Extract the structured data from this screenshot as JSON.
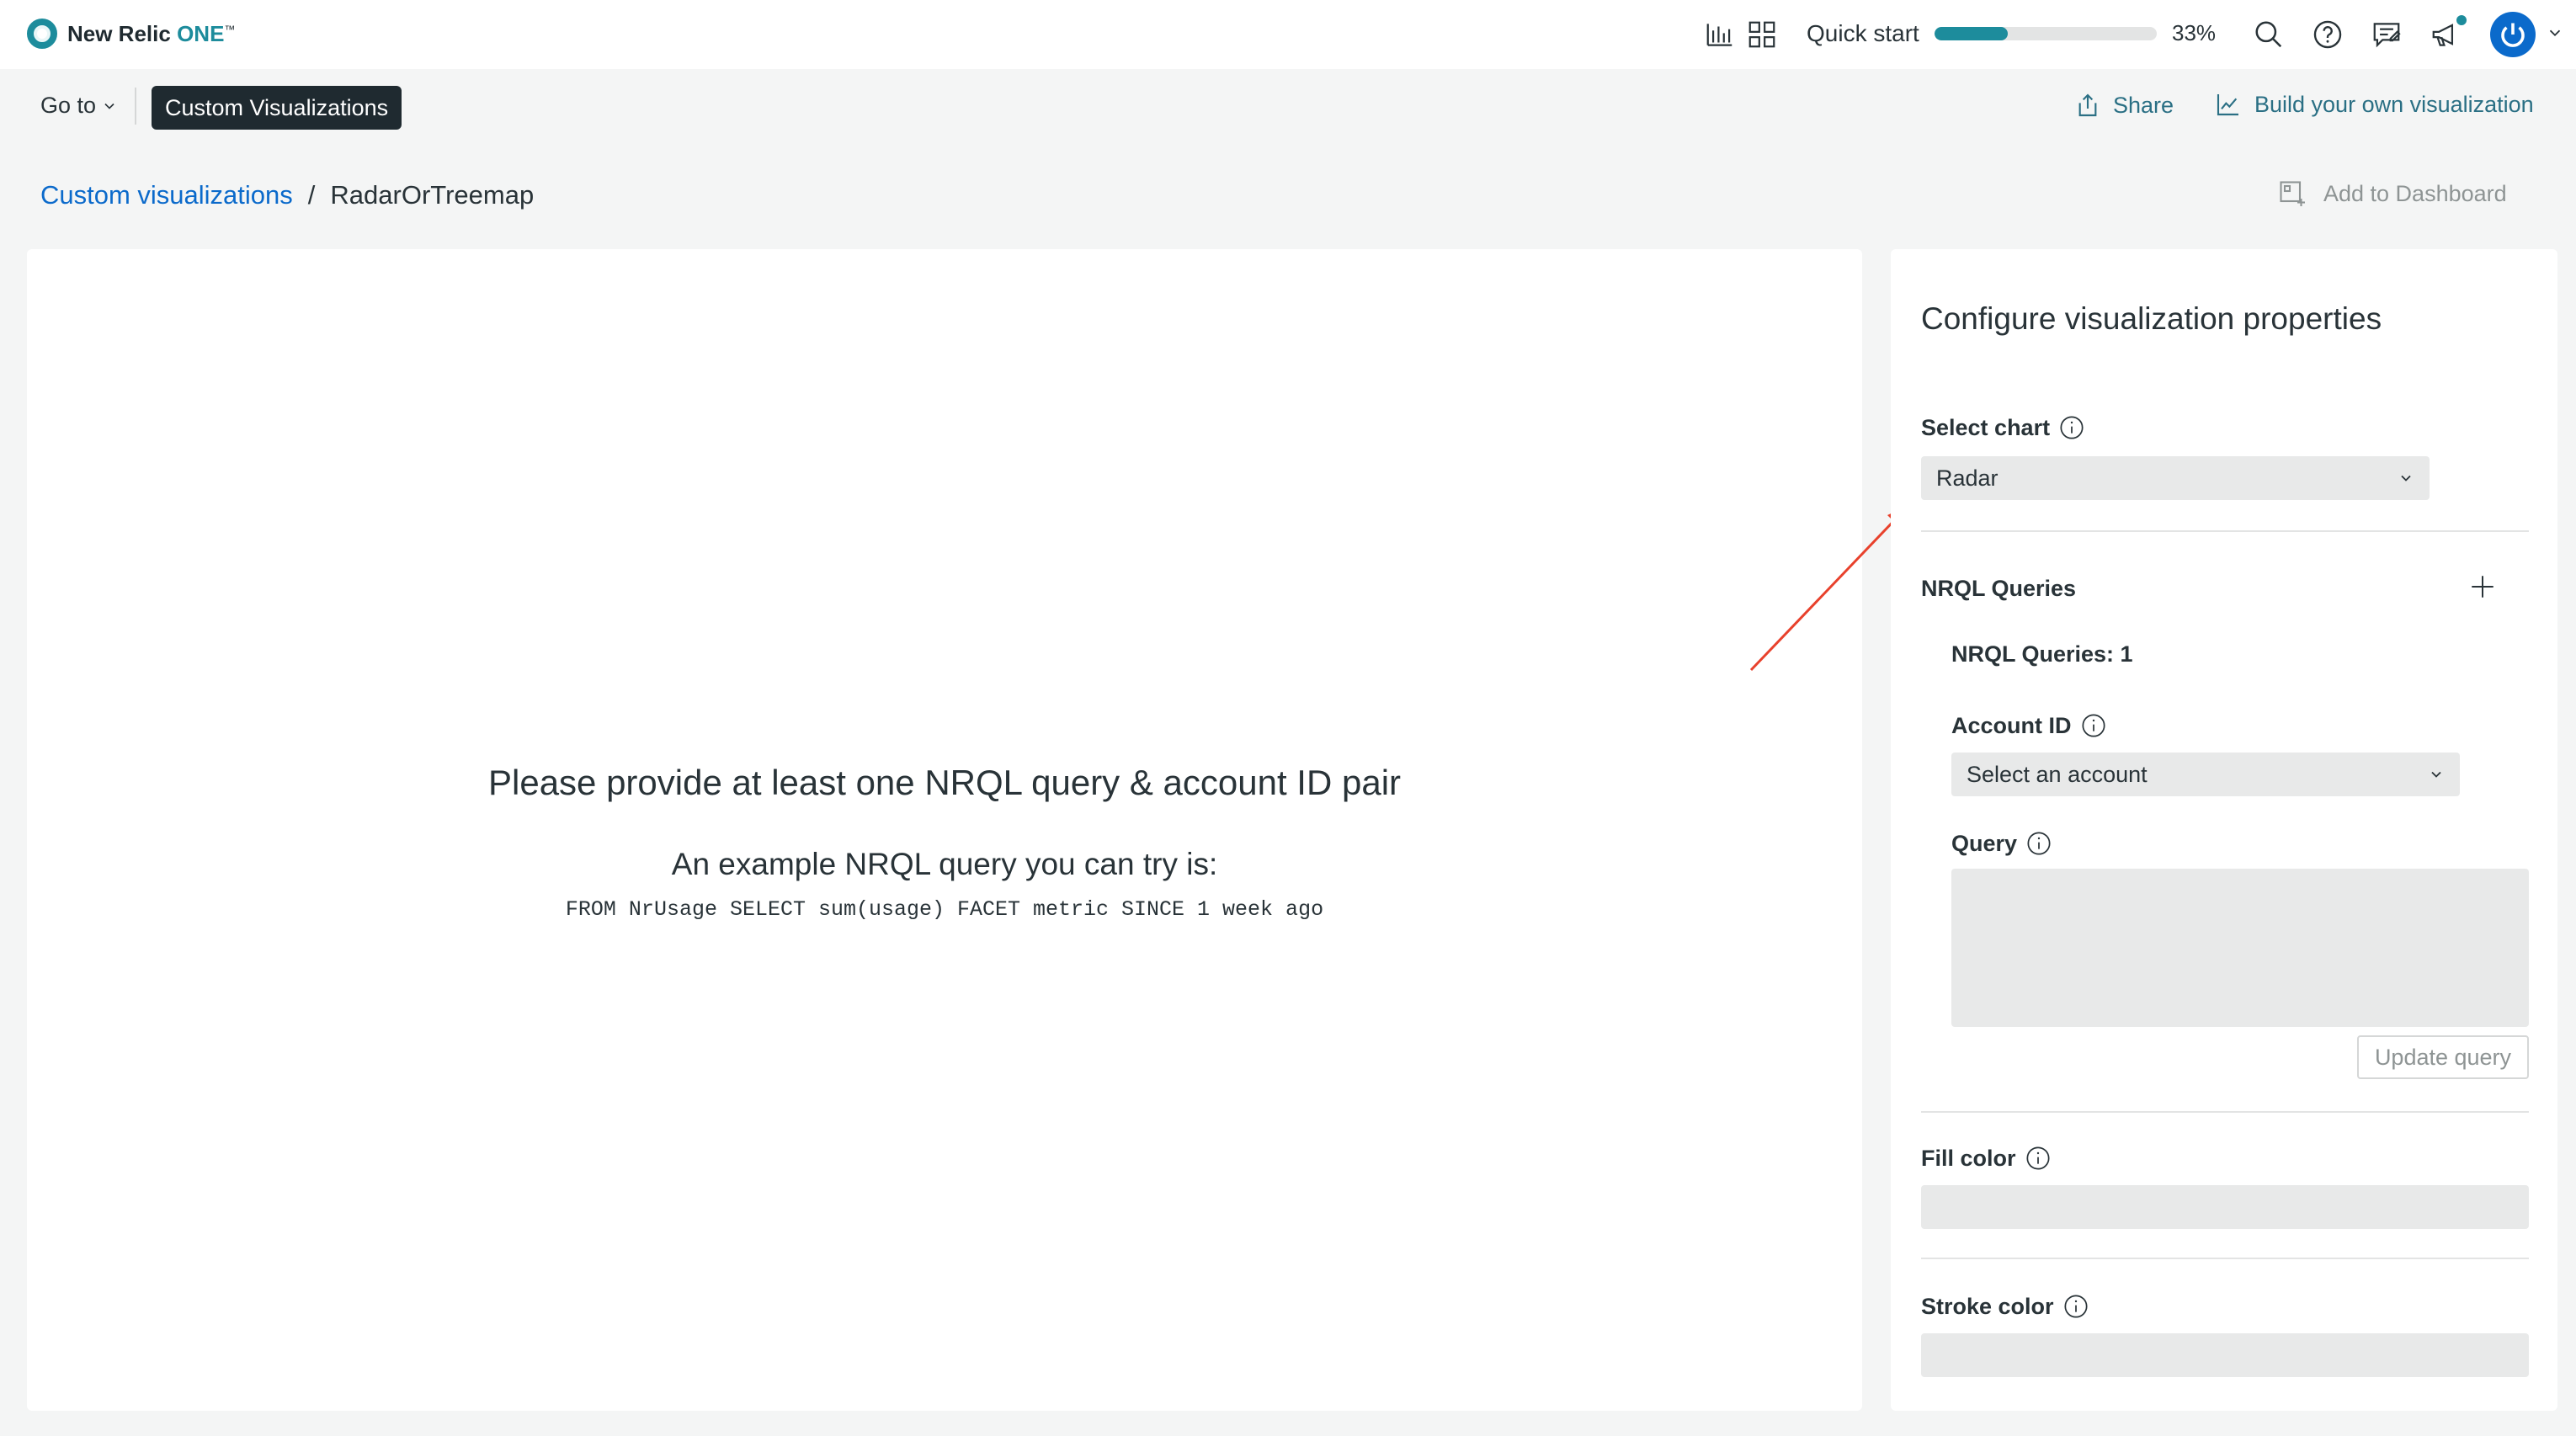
{
  "app": {
    "logo_text": "New Relic",
    "logo_accent": "ONE",
    "logo_tm": "™"
  },
  "topbar": {
    "quickstart_label": "Quick start",
    "progress_percent": 33,
    "progress_text": "33%",
    "icons": [
      "bar-chart-icon",
      "apps-grid-icon",
      "search-icon",
      "help-icon",
      "feedback-icon",
      "announcements-icon",
      "user-avatar-icon",
      "chevron-down-icon"
    ]
  },
  "nav": {
    "goto_label": "Go to",
    "active_pill": "Custom Visualizations",
    "share_label": "Share",
    "build_label": "Build your own visualization"
  },
  "breadcrumb": {
    "parent": "Custom visualizations",
    "separator": "/",
    "current": "RadarOrTreemap",
    "add_to_dashboard": "Add to Dashboard"
  },
  "main": {
    "empty_title": "Please provide at least one NRQL query & account ID pair",
    "example_label": "An example NRQL query you can try is:",
    "example_query": "FROM NrUsage SELECT sum(usage) FACET metric SINCE 1 week ago"
  },
  "config": {
    "title": "Configure visualization properties",
    "select_chart_label": "Select chart",
    "select_chart_value": "Radar",
    "nrql_section_label": "NRQL Queries",
    "nrql_count_label": "NRQL Queries: 1",
    "account_id_label": "Account ID",
    "account_placeholder": "Select an account",
    "query_label": "Query",
    "query_value": "",
    "update_query_label": "Update query",
    "fill_color_label": "Fill color",
    "fill_color_value": "",
    "stroke_color_label": "Stroke color",
    "stroke_color_value": ""
  },
  "colors": {
    "accent": "#1d8c9c",
    "link": "#0b6acb",
    "annotation_arrow": "#e8412c"
  }
}
